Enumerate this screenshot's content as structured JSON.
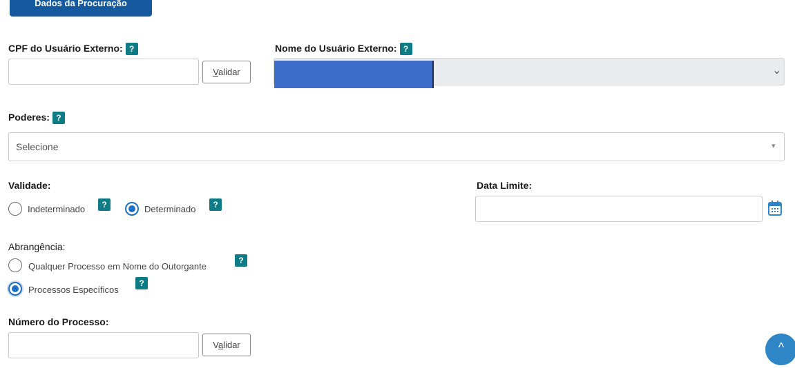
{
  "section": {
    "title": "Dados da Procuração"
  },
  "cpf": {
    "label": "CPF do Usuário Externo:",
    "value": "",
    "placeholder": "",
    "validate_label": "Validar",
    "validate_underline": "V"
  },
  "nome": {
    "label": "Nome do Usuário Externo:",
    "selected_value": "",
    "redaction_color": "#3d6cc9"
  },
  "poderes": {
    "label": "Poderes:",
    "selected": "Selecione"
  },
  "validade": {
    "label": "Validade:",
    "options": [
      {
        "label": "Indeterminado",
        "checked": false
      },
      {
        "label": "Determinado",
        "checked": true
      }
    ]
  },
  "data_limite": {
    "label": "Data Limite:",
    "value": "",
    "icon": "calendar-icon"
  },
  "abrangencia": {
    "label": "Abrangência:",
    "options": [
      {
        "label": "Qualquer Processo em Nome do Outorgante",
        "checked": false
      },
      {
        "label": "Processos Específicos",
        "checked": true
      }
    ]
  },
  "numero_processo": {
    "label": "Número do Processo:",
    "value": "",
    "validate_label": "Validar",
    "validate_underline": "a"
  },
  "help_glyph": "?",
  "select_arrow": "⌄",
  "poderes_arrow": "▾",
  "scroll_top_glyph": "^",
  "colors": {
    "primary": "#155a9e",
    "help": "#0e7c86",
    "radio": "#1d70c4",
    "scroll_top": "#2f86c7"
  }
}
